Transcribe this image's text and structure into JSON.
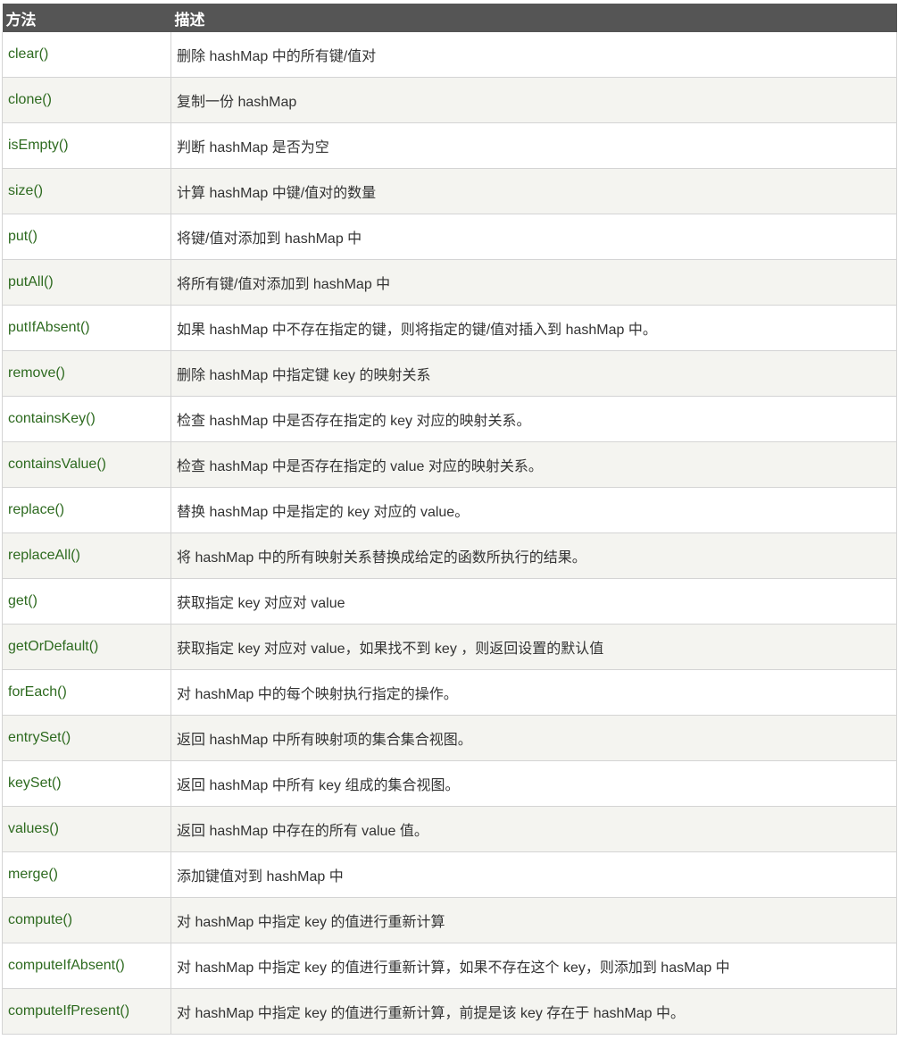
{
  "header": {
    "col_method": "方法",
    "col_desc": "描述"
  },
  "rows": [
    {
      "method": "clear()",
      "desc": "删除 hashMap 中的所有键/值对"
    },
    {
      "method": "clone()",
      "desc": "复制一份 hashMap"
    },
    {
      "method": "isEmpty()",
      "desc": "判断 hashMap 是否为空"
    },
    {
      "method": "size()",
      "desc": "计算 hashMap 中键/值对的数量"
    },
    {
      "method": "put()",
      "desc": "将键/值对添加到 hashMap 中"
    },
    {
      "method": "putAll()",
      "desc": "将所有键/值对添加到 hashMap 中"
    },
    {
      "method": "putIfAbsent()",
      "desc": "如果 hashMap 中不存在指定的键，则将指定的键/值对插入到 hashMap 中。"
    },
    {
      "method": "remove()",
      "desc": "删除 hashMap 中指定键 key 的映射关系"
    },
    {
      "method": "containsKey()",
      "desc": "检查 hashMap 中是否存在指定的 key 对应的映射关系。"
    },
    {
      "method": "containsValue()",
      "desc": "检查 hashMap 中是否存在指定的 value 对应的映射关系。"
    },
    {
      "method": "replace()",
      "desc": "替换 hashMap 中是指定的 key 对应的 value。"
    },
    {
      "method": "replaceAll()",
      "desc": "将 hashMap 中的所有映射关系替换成给定的函数所执行的结果。"
    },
    {
      "method": "get()",
      "desc": "获取指定 key 对应对 value"
    },
    {
      "method": "getOrDefault()",
      "desc": "获取指定 key 对应对 value，如果找不到 key ，则返回设置的默认值"
    },
    {
      "method": "forEach()",
      "desc": "对 hashMap 中的每个映射执行指定的操作。"
    },
    {
      "method": "entrySet()",
      "desc": "返回 hashMap 中所有映射项的集合集合视图。"
    },
    {
      "method": "keySet()",
      "desc": "返回 hashMap 中所有 key 组成的集合视图。"
    },
    {
      "method": "values()",
      "desc": "返回 hashMap 中存在的所有 value 值。"
    },
    {
      "method": "merge()",
      "desc": "添加键值对到 hashMap 中"
    },
    {
      "method": "compute()",
      "desc": "对 hashMap 中指定 key 的值进行重新计算"
    },
    {
      "method": "computeIfAbsent()",
      "desc": "对 hashMap 中指定 key 的值进行重新计算，如果不存在这个 key，则添加到 hasMap 中"
    },
    {
      "method": "computeIfPresent()",
      "desc": "对 hashMap 中指定 key 的值进行重新计算，前提是该 key 存在于 hashMap 中。"
    }
  ]
}
